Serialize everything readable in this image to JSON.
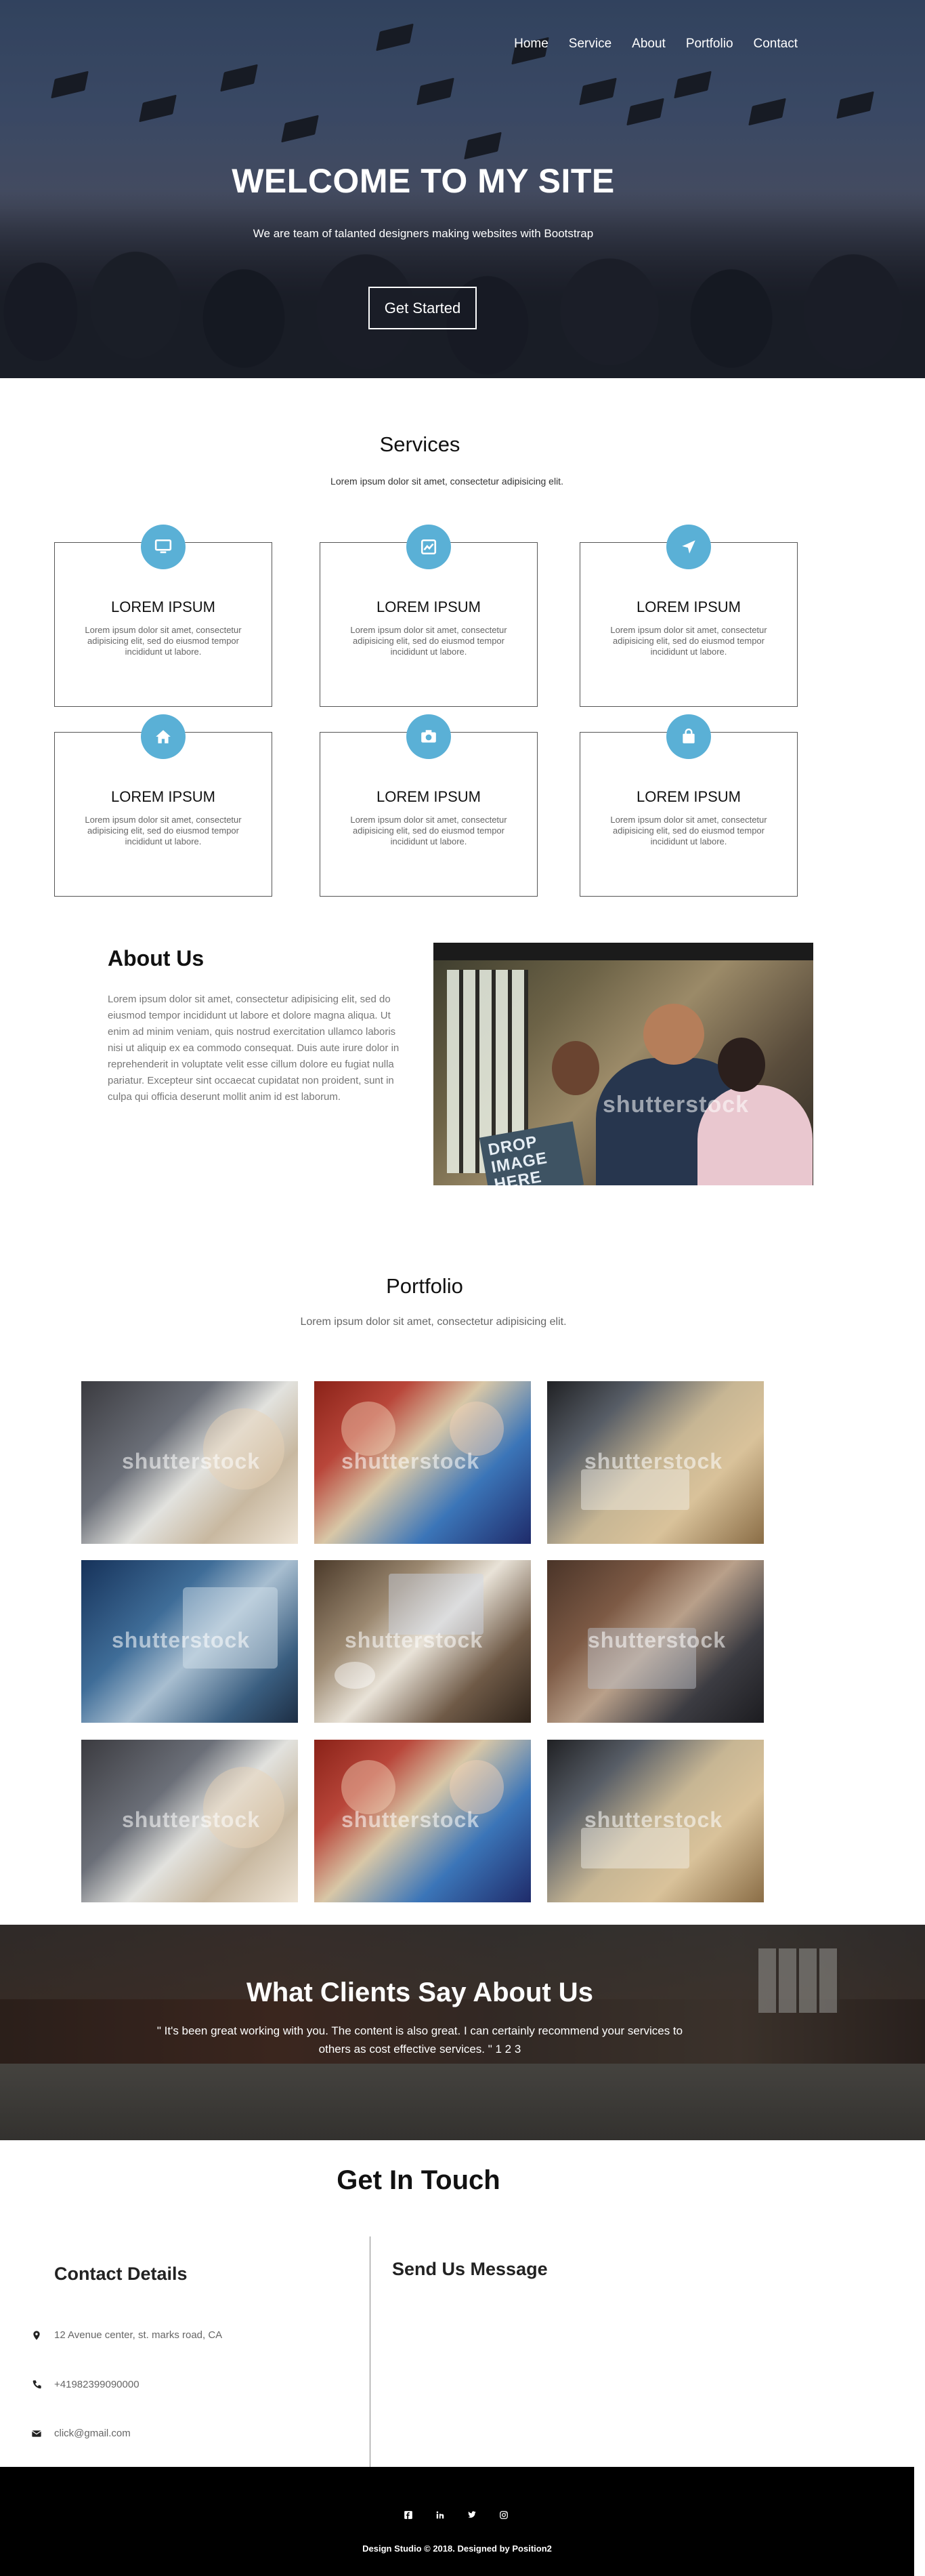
{
  "nav": {
    "items": [
      "Home",
      "Service",
      "About",
      "Portfolio",
      "Contact"
    ]
  },
  "hero": {
    "title": "WELCOME TO MY SITE",
    "subtitle": "We are team of talanted designers making websites with Bootstrap",
    "cta_label": "Get Started"
  },
  "services": {
    "title": "Services",
    "subtitle": "Lorem ipsum dolor sit amet, consectetur adipisicing elit.",
    "cards": [
      {
        "icon": "monitor-icon",
        "title": "LOREM IPSUM",
        "text": "Lorem ipsum dolor sit amet, consectetur adipisicing elit, sed do eiusmod tempor incididunt ut labore."
      },
      {
        "icon": "chart-icon",
        "title": "LOREM IPSUM",
        "text": "Lorem ipsum dolor sit amet, consectetur adipisicing elit, sed do eiusmod tempor incididunt ut labore."
      },
      {
        "icon": "location-arrow-icon",
        "title": "LOREM IPSUM",
        "text": "Lorem ipsum dolor sit amet, consectetur adipisicing elit, sed do eiusmod tempor incididunt ut labore."
      },
      {
        "icon": "home-icon",
        "title": "LOREM IPSUM",
        "text": "Lorem ipsum dolor sit amet, consectetur adipisicing elit, sed do eiusmod tempor incididunt ut labore."
      },
      {
        "icon": "camera-icon",
        "title": "LOREM IPSUM",
        "text": "Lorem ipsum dolor sit amet, consectetur adipisicing elit, sed do eiusmod tempor incididunt ut labore."
      },
      {
        "icon": "shopping-bag-icon",
        "title": "LOREM IPSUM",
        "text": "Lorem ipsum dolor sit amet, consectetur adipisicing elit, sed do eiusmod tempor incididunt ut labore."
      }
    ],
    "accent_color": "#5ab0d6"
  },
  "about": {
    "title": "About Us",
    "text": "Lorem ipsum dolor sit amet, consectetur adipisicing elit, sed do eiusmod tempor incididunt ut labore et dolore magna aliqua. Ut enim ad minim veniam, quis nostrud exercitation ullamco laboris nisi ut aliquip ex ea commodo consequat. Duis aute irure dolor in reprehenderit in voluptate velit esse cillum dolore eu fugiat nulla pariatur. Excepteur sint occaecat cupidatat non proident, sunt in culpa qui officia deserunt mollit anim id est laborum.",
    "image_caption": "DROP IMAGE HERE",
    "watermark": "shutterstock"
  },
  "portfolio": {
    "title": "Portfolio",
    "subtitle": "Lorem ipsum dolor sit amet, consectetur adipisicing elit.",
    "watermark": "shutterstock"
  },
  "testimonials": {
    "title": "What Clients Say About Us",
    "quote": "\" It's been great working with you. The content is also great. I can certainly recommend your services to others as cost effective services. \" 1 2 3"
  },
  "contact": {
    "title": "Get In Touch",
    "details_title": "Contact Details",
    "address": "12 Avenue center, st. marks road, CA",
    "phone": "+41982399090000",
    "email": "click@gmail.com",
    "message_title": "Send Us Message"
  },
  "footer": {
    "social": [
      "facebook-icon",
      "linkedin-icon",
      "twitter-icon",
      "instagram-icon"
    ],
    "copyright": "Design Studio © 2018. Designed by Position2"
  }
}
